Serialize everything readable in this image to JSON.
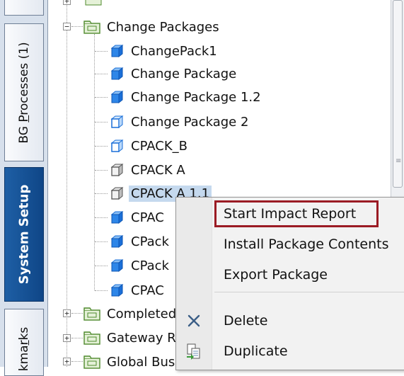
{
  "tabs": [
    {
      "label_pre": "",
      "label_u": "",
      "label_post": ""
    },
    {
      "label_pre": "BG ",
      "label_u": "P",
      "label_post": "rocesses (1)"
    },
    {
      "label_pre": "System Setup",
      "label_u": "",
      "label_post": ""
    },
    {
      "label_pre": "kma",
      "label_u": "r",
      "label_post": "ks"
    }
  ],
  "tree": {
    "root_label": "Change Packages",
    "items": [
      {
        "label": "ChangePack1",
        "icon": "package-blue-icon"
      },
      {
        "label": "Change Package",
        "icon": "package-blue-icon"
      },
      {
        "label": "Change Package 1.2",
        "icon": "package-blue-icon"
      },
      {
        "label": "Change Package 2",
        "icon": "package-blue-icon"
      },
      {
        "label": "CPACK_B",
        "icon": "package-blue-icon"
      },
      {
        "label": "CPACK A",
        "icon": "package-gray-icon"
      },
      {
        "label": "CPACK A 1.1",
        "icon": "package-gray-icon"
      },
      {
        "label": "CPAC",
        "icon": "package-blue-icon"
      },
      {
        "label": "CPack",
        "icon": "package-blue-icon"
      },
      {
        "label": "CPack",
        "icon": "package-blue-icon"
      },
      {
        "label": "CPAC",
        "icon": "package-blue-icon"
      }
    ],
    "siblings": [
      {
        "label": "Completed"
      },
      {
        "label": "Gateway R"
      },
      {
        "label": "Global Bus"
      }
    ]
  },
  "context_menu": {
    "items": [
      {
        "label": "Start Impact Report",
        "icon": ""
      },
      {
        "label": "Install Package Contents",
        "icon": ""
      },
      {
        "label": "Export Package",
        "icon": ""
      },
      {
        "label": "Delete",
        "icon": "delete-x-icon"
      },
      {
        "label": "Duplicate",
        "icon": "duplicate-icon"
      }
    ]
  },
  "colors": {
    "active_tab": "#1559a0",
    "highlight_border": "#9b1b24",
    "selection": "#c5d9ee",
    "package_blue": "#1a6fd8",
    "folder_green": "#6aa84f"
  }
}
